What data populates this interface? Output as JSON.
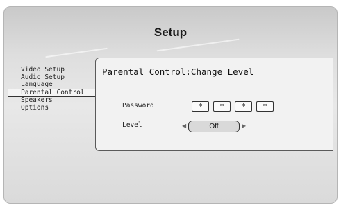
{
  "header": {
    "title": "Setup"
  },
  "menu": {
    "items": [
      {
        "label": "Video Setup"
      },
      {
        "label": "Audio Setup"
      },
      {
        "label": "Language"
      },
      {
        "label": "Parental Control"
      },
      {
        "label": "Speakers"
      },
      {
        "label": "Options"
      }
    ],
    "selected_index": 3
  },
  "panel": {
    "title": "Parental Control:Change Level",
    "password": {
      "label": "Password",
      "digits": [
        "*",
        "*",
        "*",
        "*"
      ]
    },
    "level": {
      "label": "Level",
      "value": "Off",
      "left_arrow_icon": "triangle-left-icon",
      "right_arrow_icon": "triangle-right-icon"
    }
  }
}
